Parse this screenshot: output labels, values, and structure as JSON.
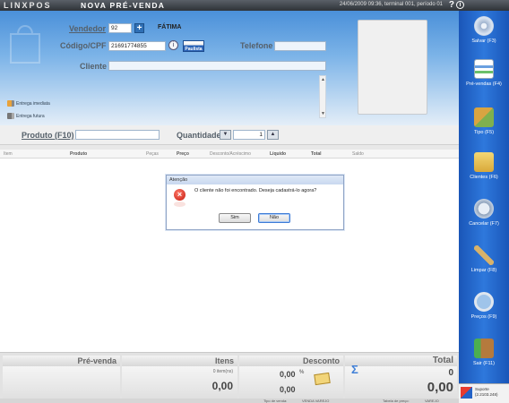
{
  "titlebar": {
    "logo": "LINXPOS",
    "title": "Nova pré-venda",
    "session": "24/06/2009 09:36, terminal 001, período 01",
    "help": "?",
    "info": "i"
  },
  "header": {
    "vendedor_label": "Vendedor",
    "vendedor_value": "92",
    "vendedor_name": "FÁTIMA",
    "codigo_label": "Código/CPF",
    "codigo_value": "21691774855",
    "telefone_label": "Telefone",
    "telefone_value": "",
    "cliente_label": "Cliente",
    "cliente_value": "",
    "np_logo": "Paulista",
    "entrega_imediata": "Entrega imediata",
    "entrega_futura": "Entrega futura",
    "scroll_up": "▲",
    "scroll_down": "▼"
  },
  "product": {
    "produto_label": "Produto (F10)",
    "produto_value": "",
    "quantidade_label": "Quantidade",
    "quantidade_value": "1",
    "spin_down": "▼",
    "spin_up": "▲"
  },
  "grid": {
    "columns": [
      {
        "label": "Item",
        "bold": false
      },
      {
        "label": "Produto",
        "bold": true
      },
      {
        "label": "Peças",
        "bold": false
      },
      {
        "label": "Preço",
        "bold": true
      },
      {
        "label": "Desconto/Acréscimo",
        "bold": false
      },
      {
        "label": "Líquido",
        "bold": true
      },
      {
        "label": "Total",
        "bold": true
      },
      {
        "label": "Saldo",
        "bold": false
      }
    ]
  },
  "dialog": {
    "title": "Atenção",
    "message": "O cliente não foi encontrado. Deseja cadastrá-lo agora?",
    "yes_label": "Sim",
    "no_label": "Não",
    "icon": "×"
  },
  "totals": {
    "prevenda_label": "Pré-venda",
    "itens_label": "Itens",
    "itens_count": "0 item(ns)",
    "itens_value": "0,00",
    "desconto_label": "Desconto",
    "desconto_value": "0,00",
    "desconto_pct": "%",
    "desconto_value2": "0,00",
    "sigma": "Σ",
    "total_label": "Total",
    "total_qty": "0",
    "total_value": "0,00"
  },
  "statusbar": {
    "tipo_label": "Tipo de venda:",
    "tipo_value": "VENDA VAREJO",
    "tabela_label": "Tabela de preço:",
    "tabela_value": "VAREJO"
  },
  "sidebar": {
    "items": [
      {
        "label": "Salvar (F3)",
        "icon": "save-disc-icon",
        "color": "#c9d6e8"
      },
      {
        "label": "Pré-vendas (F4)",
        "icon": "presales-list-icon",
        "color": "#dfe8f5"
      },
      {
        "label": "Tipo (F5)",
        "icon": "type-icon",
        "color": "#8fbf58"
      },
      {
        "label": "Clientes (F6)",
        "icon": "clients-folder-icon",
        "color": "#e9c65a"
      },
      {
        "label": "Cancelar (F7)",
        "icon": "cancel-icon",
        "color": "#b9c6d6"
      },
      {
        "label": "Limpar (F8)",
        "icon": "broom-icon",
        "color": "#d8b26a"
      },
      {
        "label": "Preços (F9)",
        "icon": "price-magnifier-icon",
        "color": "#cfd8e3"
      },
      {
        "label": "Sair (F11)",
        "icon": "exit-door-icon",
        "color": "#b57a3d"
      }
    ],
    "footer_line1": "Suporte",
    "footer_line2": "(2.2103.248)"
  }
}
